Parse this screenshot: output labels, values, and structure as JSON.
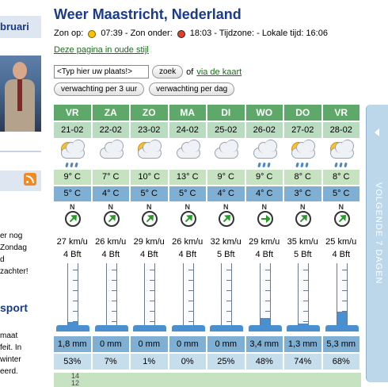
{
  "sidebar": {
    "header_label": "bruari",
    "text_lines": [
      "er nog",
      "Zondag",
      "d",
      "zachter!"
    ],
    "sport_label": "sport",
    "text_lines_2": [
      "maat",
      "feit. In",
      "winter",
      "eerd."
    ]
  },
  "header": {
    "title": "Weer Maastricht, Nederland",
    "sunrise_label": "Zon op:",
    "sunrise_time": "07:39",
    "sunset_label": "- Zon onder:",
    "sunset_time": "18:03",
    "timezone_label": "- Tijdzone: - Lokale tijd:",
    "local_time": "16:06",
    "old_style_link": "Deze pagina in oude stijl"
  },
  "search": {
    "placeholder": "<Typ hier uw plaats!>",
    "value": "<Typ hier uw plaats!>",
    "search_button": "zoek",
    "of_text": "of",
    "map_link": "via de kaart",
    "btn_3hour": "verwachting per 3 uur",
    "btn_day": "verwachting per dag"
  },
  "forecast": {
    "days": [
      {
        "day": "VR",
        "date": "21-02",
        "icon": "sun-cloud-rain-icon",
        "max": "9° C",
        "min": "5° C",
        "dir": "N",
        "arrow_deg": 45,
        "wind": "27 km/u",
        "bft": "4 Bft",
        "rain": "1,8 mm",
        "pct": "53%",
        "fill_frac": 0.08
      },
      {
        "day": "ZA",
        "date": "22-02",
        "icon": "cloud-icon",
        "max": "7° C",
        "min": "4° C",
        "dir": "N",
        "arrow_deg": 45,
        "wind": "26 km/u",
        "bft": "4 Bft",
        "rain": "0 mm",
        "pct": "7%",
        "fill_frac": 0
      },
      {
        "day": "ZO",
        "date": "23-02",
        "icon": "sun-cloud-icon",
        "max": "10° C",
        "min": "5° C",
        "dir": "N",
        "arrow_deg": 45,
        "wind": "29 km/u",
        "bft": "4 Bft",
        "rain": "0 mm",
        "pct": "1%",
        "fill_frac": 0
      },
      {
        "day": "MA",
        "date": "24-02",
        "icon": "cloud-icon",
        "max": "13° C",
        "min": "5° C",
        "dir": "N",
        "arrow_deg": 45,
        "wind": "26 km/u",
        "bft": "4 Bft",
        "rain": "0 mm",
        "pct": "0%",
        "fill_frac": 0
      },
      {
        "day": "DI",
        "date": "25-02",
        "icon": "cloud-icon",
        "max": "9° C",
        "min": "4° C",
        "dir": "N",
        "arrow_deg": 45,
        "wind": "32 km/u",
        "bft": "5 Bft",
        "rain": "0 mm",
        "pct": "25%",
        "fill_frac": 0
      },
      {
        "day": "WO",
        "date": "26-02",
        "icon": "cloud-rain-icon",
        "max": "9° C",
        "min": "4° C",
        "dir": "N",
        "arrow_deg": 90,
        "wind": "29 km/u",
        "bft": "4 Bft",
        "rain": "3,4 mm",
        "pct": "48%",
        "fill_frac": 0.15
      },
      {
        "day": "DO",
        "date": "27-02",
        "icon": "sun-cloud-rain-icon",
        "max": "8° C",
        "min": "3° C",
        "dir": "N",
        "arrow_deg": 45,
        "wind": "35 km/u",
        "bft": "5 Bft",
        "rain": "1,3 mm",
        "pct": "74%",
        "fill_frac": 0.06
      },
      {
        "day": "VR",
        "date": "28-02",
        "icon": "sun-cloud-rain-icon",
        "max": "8° C",
        "min": "5° C",
        "dir": "N",
        "arrow_deg": 45,
        "wind": "25 km/u",
        "bft": "4 Bft",
        "rain": "5,3 mm",
        "pct": "68%",
        "fill_frac": 0.24
      }
    ],
    "bottom_numbers": [
      "14",
      "12"
    ]
  },
  "next_tab_label": "VOLGENDE 7 DAGEN",
  "colors": {
    "day_header": "#5ea96a",
    "max_row": "#c6e2c0",
    "min_row": "#7fb0d4",
    "title_blue": "#1a3a8a",
    "arrow_green": "#2a9a2a",
    "rain_fill": "#4a90d0"
  }
}
